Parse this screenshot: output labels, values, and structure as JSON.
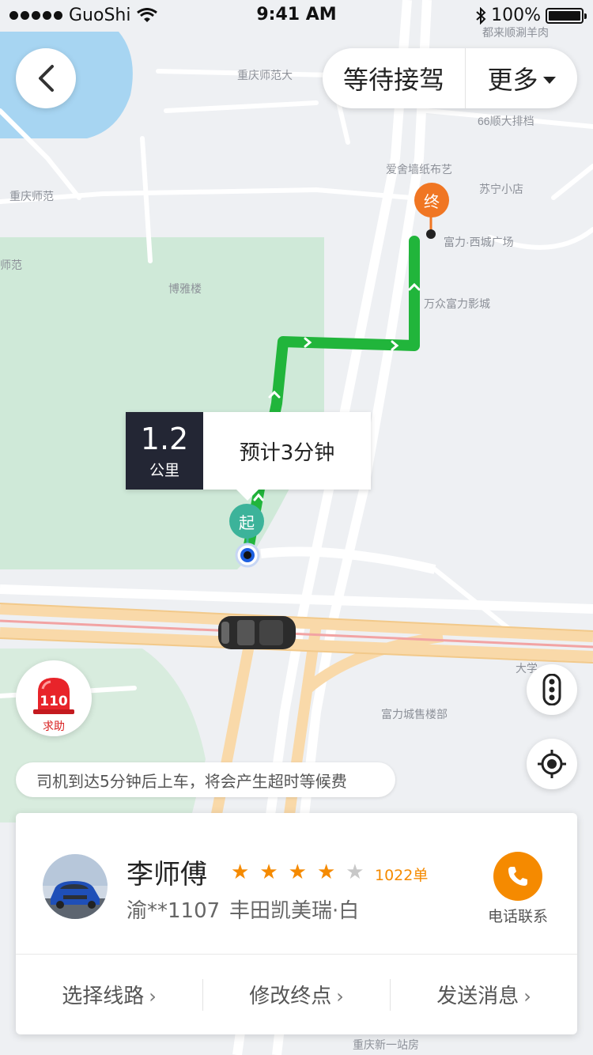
{
  "status_bar": {
    "carrier": "GuoShi",
    "time": "9:41 AM",
    "battery": "100%"
  },
  "header": {
    "ride_status": "等待接驾",
    "more_label": "更多"
  },
  "map": {
    "labels": [
      "都来顺涮羊肉",
      "重庆师范大",
      "66顺大排档",
      "爱舍墙纸布艺",
      "苏宁小店",
      "重庆师范",
      "师范",
      "富力·西城广场",
      "博雅楼",
      "万众富力影城",
      "大学",
      "富力城售楼部",
      "重庆新一站房"
    ]
  },
  "route_info": {
    "distance": "1.2",
    "distance_unit": "公里",
    "eta": "预计3分钟",
    "start_marker": "起",
    "end_marker": "终"
  },
  "sos": {
    "number": "110",
    "label": "求助"
  },
  "notice": "司机到达5分钟后上车，将会产生超时等候费",
  "driver": {
    "name": "李师傅",
    "rating": 4,
    "rating_max": 5,
    "orders": "1022单",
    "plate": "渝**1107",
    "car": "丰田凯美瑞·白",
    "call_label": "电话联系"
  },
  "actions": {
    "route": "选择线路",
    "destination": "修改终点",
    "message": "发送消息"
  },
  "colors": {
    "route": "#21b53b",
    "accent": "#f58a00",
    "start": "#3cb39a",
    "end": "#f07623"
  },
  "icons": [
    "back-icon",
    "caret-down-icon",
    "wifi-icon",
    "bluetooth-icon",
    "battery-icon",
    "siren-icon",
    "traffic-light-icon",
    "locate-icon",
    "phone-icon",
    "car-icon"
  ]
}
